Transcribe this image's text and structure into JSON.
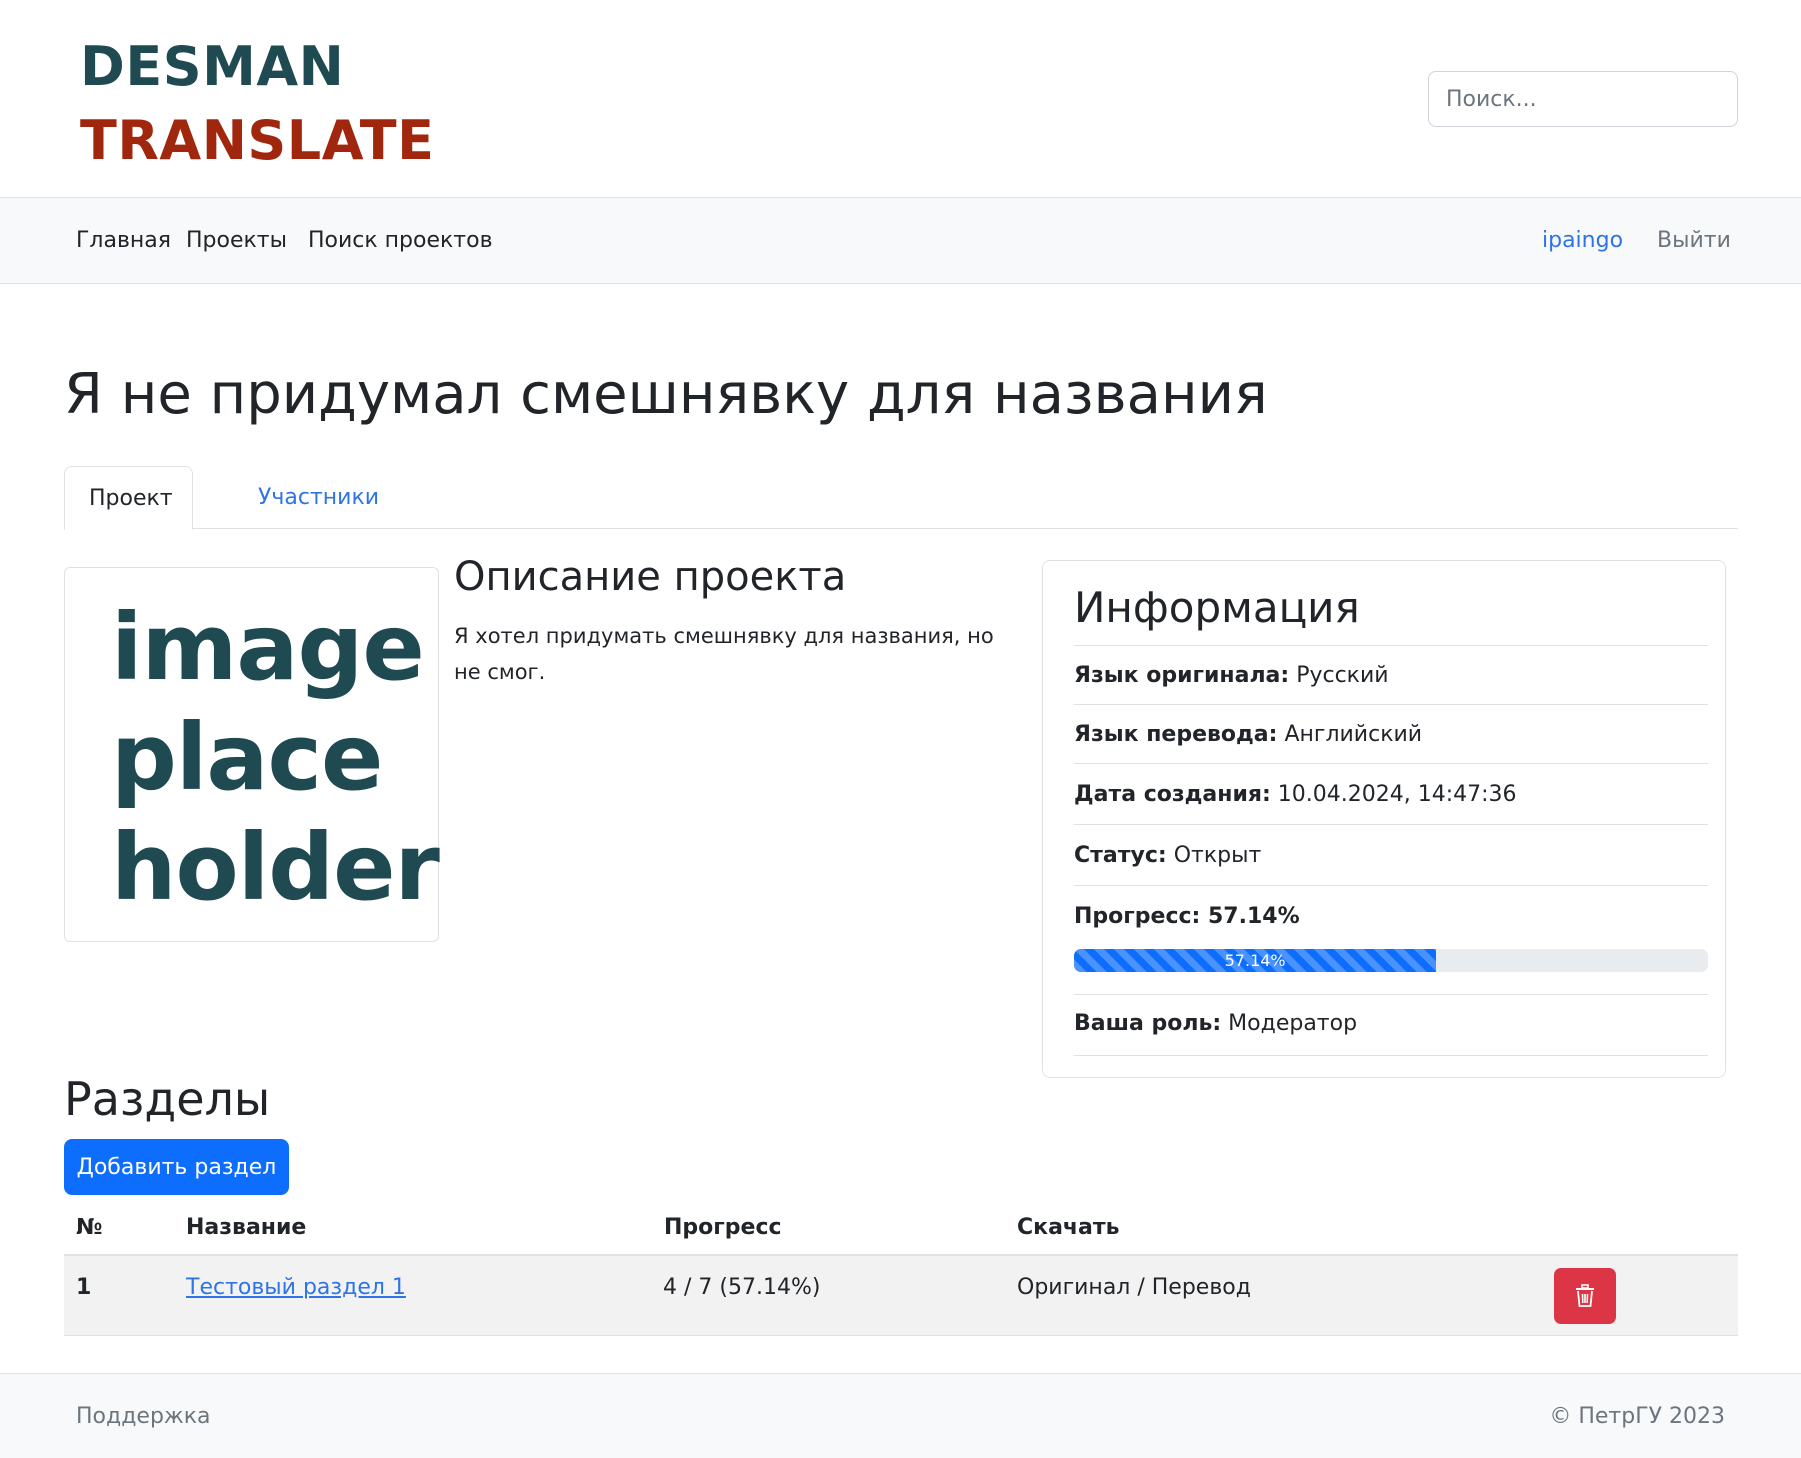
{
  "header": {
    "logo_line1": "DESMAN",
    "logo_line2": "TRANSLATE",
    "search_placeholder": "Поиск..."
  },
  "navbar": {
    "items": [
      "Главная",
      "Проекты",
      "Поиск проектов"
    ],
    "user": "ipaingo",
    "logout": "Выйти"
  },
  "project": {
    "title": "Я не придумал смешнявку для названия",
    "tabs": [
      "Проект",
      "Участники"
    ],
    "image_placeholder": [
      "image",
      "place",
      "holder"
    ],
    "description_title": "Описание проекта",
    "description": "Я хотел придумать смешнявку для названия, но не смог."
  },
  "info": {
    "title": "Информация",
    "source_language_label": "Язык оригинала:",
    "source_language": "Русский",
    "target_language_label": "Язык перевода:",
    "target_language": "Английский",
    "created_label": "Дата создания:",
    "created": "10.04.2024, 14:47:36",
    "status_label": "Статус:",
    "status": "Открыт",
    "progress_label": "Прогресс: 57.14%",
    "progress_percent": 57.14,
    "progress_text": "57.14%",
    "role_label": "Ваша роль:",
    "role": "Модератор"
  },
  "sections": {
    "title": "Разделы",
    "add_button": "Добавить раздел",
    "columns": [
      "№",
      "Название",
      "Прогресс",
      "Скачать"
    ],
    "rows": [
      {
        "number": "1",
        "name": "Тестовый раздел 1",
        "progress": "4 / 7 (57.14%)",
        "download": "Оригинал / Перевод"
      }
    ]
  },
  "footer": {
    "support": "Поддержка",
    "copyright": "© ПетрГУ 2023"
  },
  "colors": {
    "primary": "#0d6efd",
    "danger": "#dc3545",
    "logo_dark": "#1f4a51",
    "logo_red": "#a0270d"
  }
}
